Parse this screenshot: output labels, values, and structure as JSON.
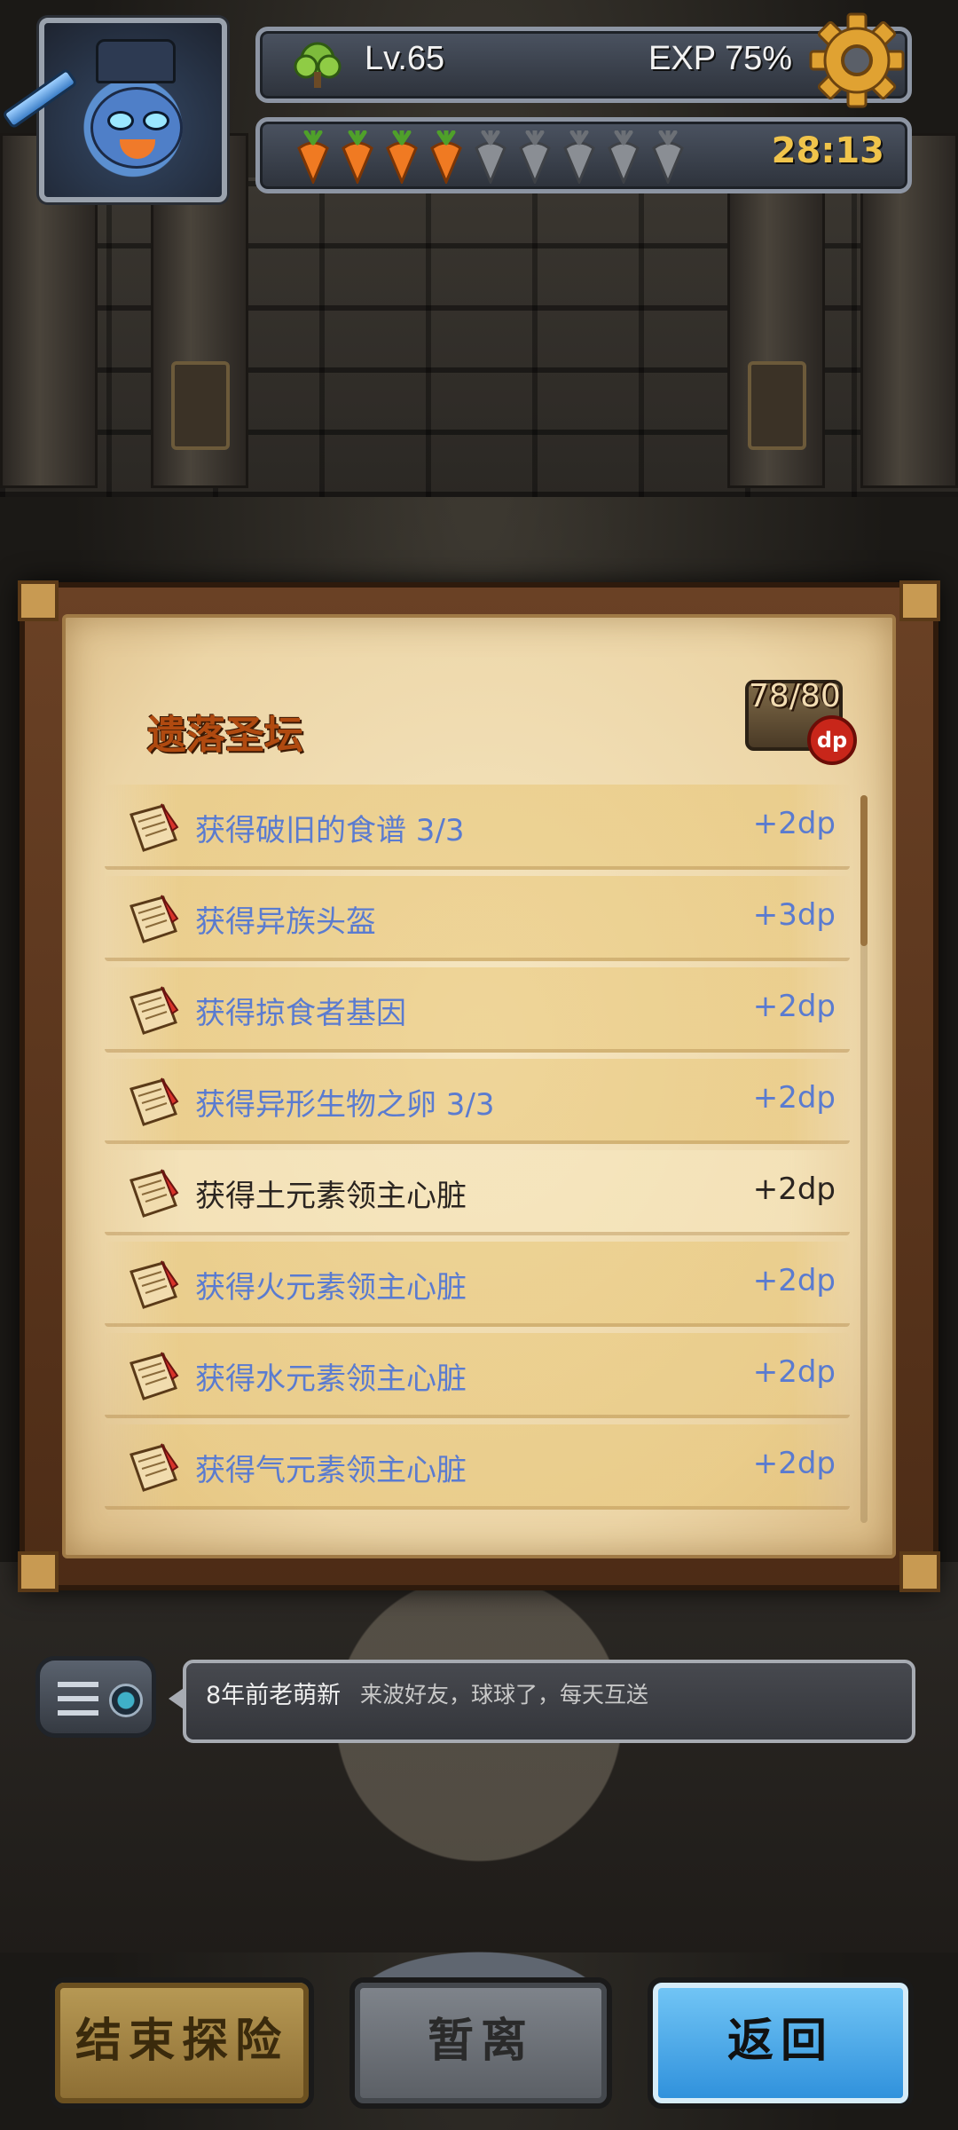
{
  "header": {
    "level_label": "Lv.65",
    "exp_label": "EXP 75%",
    "stamina": {
      "filled": 4,
      "total": 9
    },
    "timer": "28:13",
    "icons": {
      "avatar": "player-avatar",
      "tree": "tree-icon",
      "gear": "gear-icon",
      "carrot": "carrot-icon"
    }
  },
  "panel": {
    "title": "遗落圣坛",
    "progress": "78/80",
    "badge": "dp",
    "items": [
      {
        "name": "获得破旧的食谱 3/3",
        "points": "+2dp",
        "done": false
      },
      {
        "name": "获得异族头盔",
        "points": "+3dp",
        "done": false
      },
      {
        "name": "获得掠食者基因",
        "points": "+2dp",
        "done": false
      },
      {
        "name": "获得异形生物之卵 3/3",
        "points": "+2dp",
        "done": false
      },
      {
        "name": "获得土元素领主心脏",
        "points": "+2dp",
        "done": true
      },
      {
        "name": "获得火元素领主心脏",
        "points": "+2dp",
        "done": false
      },
      {
        "name": "获得水元素领主心脏",
        "points": "+2dp",
        "done": false
      },
      {
        "name": "获得气元素领主心脏",
        "points": "+2dp",
        "done": false
      }
    ],
    "colors": {
      "pending_text": "#5a7bd0",
      "done_text": "#2a2420",
      "title": "#b04a10"
    }
  },
  "chat": {
    "user": "8年前老萌新",
    "message": "来波好友，球球了，每天互送"
  },
  "buttons": {
    "end": "结束探险",
    "away": "暂离",
    "back": "返回"
  }
}
